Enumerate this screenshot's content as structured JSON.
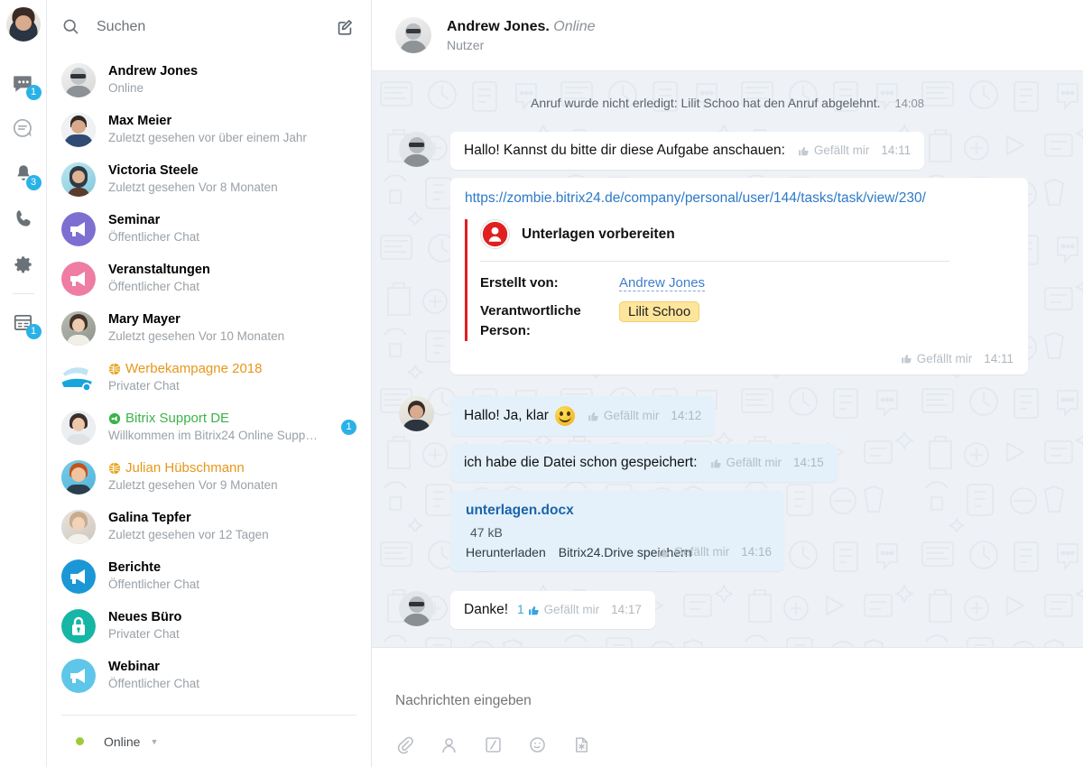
{
  "rail": {
    "avatar_name": "user-avatar",
    "items": [
      {
        "name": "chat-icon",
        "badge": "1"
      },
      {
        "name": "comment-icon",
        "badge": ""
      },
      {
        "name": "bell-icon",
        "badge": "3"
      },
      {
        "name": "phone-icon",
        "badge": ""
      },
      {
        "name": "gear-icon",
        "badge": ""
      },
      {
        "name": "forms-icon",
        "badge": "1"
      }
    ]
  },
  "search": {
    "placeholder": "Suchen",
    "value": ""
  },
  "chats": [
    {
      "title": "Andrew Jones",
      "sub": "Online",
      "avatar": "andrew",
      "style": "normal",
      "icon": "",
      "badge": ""
    },
    {
      "title": "Max Meier",
      "sub": "Zuletzt gesehen vor über einem Jahr",
      "avatar": "max",
      "style": "normal",
      "icon": "",
      "badge": ""
    },
    {
      "title": "Victoria Steele",
      "sub": "Zuletzt gesehen Vor 8 Monaten",
      "avatar": "victoria",
      "style": "normal",
      "icon": "",
      "badge": ""
    },
    {
      "title": "Seminar",
      "sub": "Öffentlicher Chat",
      "avatar": "megaphone-purple",
      "style": "normal",
      "icon": "",
      "badge": ""
    },
    {
      "title": "Veranstaltungen",
      "sub": "Öffentlicher Chat",
      "avatar": "megaphone-pink",
      "style": "normal",
      "icon": "",
      "badge": ""
    },
    {
      "title": "Mary Mayer",
      "sub": "Zuletzt gesehen Vor 10 Monaten",
      "avatar": "mary",
      "style": "normal",
      "icon": "",
      "badge": ""
    },
    {
      "title": "Werbekampagne 2018",
      "sub": "Privater Chat",
      "avatar": "campaign",
      "style": "orange",
      "icon": "globe-icon",
      "badge": ""
    },
    {
      "title": "Bitrix Support DE",
      "sub": "Willkommen im Bitrix24 Online Supp…",
      "avatar": "support",
      "style": "green",
      "icon": "support-icon",
      "badge": "1"
    },
    {
      "title": "Julian Hübschmann",
      "sub": "Zuletzt gesehen Vor 9 Monaten",
      "avatar": "julian",
      "style": "orange",
      "icon": "globe-icon",
      "badge": ""
    },
    {
      "title": "Galina Tepfer",
      "sub": "Zuletzt gesehen vor 12 Tagen",
      "avatar": "galina",
      "style": "normal",
      "icon": "",
      "badge": ""
    },
    {
      "title": "Berichte",
      "sub": "Öffentlicher Chat",
      "avatar": "megaphone-blue",
      "style": "normal",
      "icon": "",
      "badge": ""
    },
    {
      "title": "Neues Büro",
      "sub": "Privater Chat",
      "avatar": "lock-teal",
      "style": "normal",
      "icon": "",
      "badge": ""
    },
    {
      "title": "Webinar",
      "sub": "Öffentlicher Chat",
      "avatar": "megaphone-lightblue",
      "style": "normal",
      "icon": "",
      "badge": ""
    }
  ],
  "status_bar": {
    "label": "Online",
    "color": "#9dcb3b"
  },
  "conversation": {
    "name": "Andrew Jones.",
    "status": "Online",
    "subtitle": "Nutzer",
    "system_message": {
      "text": "Anruf wurde nicht erledigt: Lilit Schoo hat den Anruf abgelehnt.",
      "time": "14:08"
    },
    "messages": [
      {
        "id": "m1",
        "text": "Hallo! Kannst du bitte dir diese Aufgabe anschauen:",
        "like": "Gefällt mir",
        "time": "14:11"
      },
      {
        "id": "m3",
        "text": "Hallo! Ja, klar",
        "like": "Gefällt mir",
        "time": "14:12"
      },
      {
        "id": "m4",
        "text": "ich habe die Datei schon gespeichert:",
        "like": "Gefällt mir",
        "time": "14:15"
      },
      {
        "id": "m6",
        "text": "Danke!",
        "like": "Gefällt mir",
        "time": "14:17",
        "like_count": "1"
      }
    ],
    "task_card": {
      "url": "https://zombie.bitrix24.de/company/personal/user/144/tasks/task/view/230/",
      "title": "Unterlagen vorbereiten",
      "fields": [
        {
          "label": "Erstellt von:",
          "value": "Andrew Jones",
          "type": "link"
        },
        {
          "label": "Verantwortliche Person:",
          "value": "Lilit Schoo",
          "type": "pill"
        }
      ],
      "like": "Gefällt mir",
      "time": "14:11",
      "accent_color": "#e02020"
    },
    "file_card": {
      "name": "unterlagen.docx",
      "size": "47 kB",
      "download": "Herunterladen",
      "save": "Bitrix24.Drive speichern",
      "like": "Gefällt mir",
      "time": "14:16"
    }
  },
  "composer": {
    "placeholder": "Nachrichten eingeben",
    "value": "",
    "tools": [
      "attach-icon",
      "mention-icon",
      "command-icon",
      "emoji-icon",
      "file-icon"
    ]
  }
}
